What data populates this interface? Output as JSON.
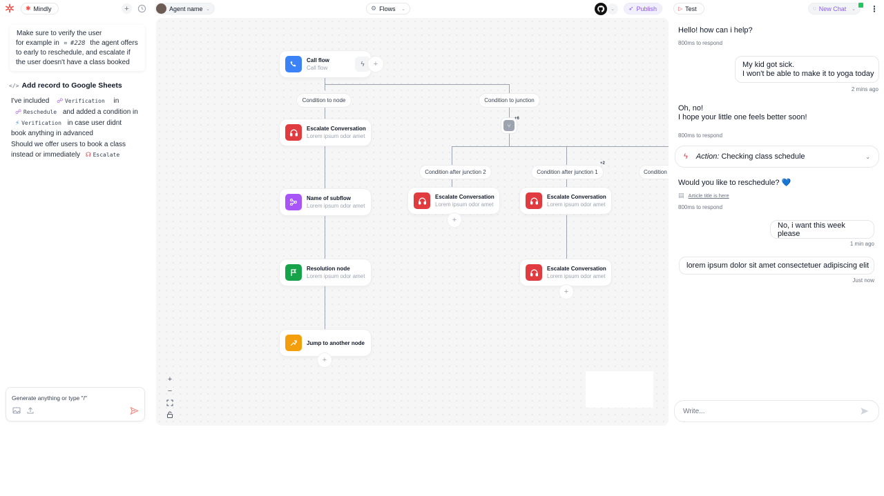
{
  "header": {
    "brand_name": "Mindly",
    "agent_name": "Agent name",
    "flows_label": "Flows",
    "publish_label": "Publish",
    "test_label": "Test",
    "new_chat_label": "New Chat"
  },
  "left_panel": {
    "note": {
      "line1": "Make sure to verify the user",
      "line2a": "for example in",
      "line2_ref": "#228",
      "line2b": "the agent offers",
      "line3": "to early to reschedule, and escalate if",
      "line4": "the user doesn't have a class booked"
    },
    "action_title": "Add record to Google Sheets",
    "description": {
      "l1_pre": "I've included",
      "tag_verification": "Verification",
      "l1_post": "in",
      "tag_reschedule": "Reschedule",
      "l2_post": "and added a condition in",
      "tag_verification2": "Verification",
      "l3_post": "in case user didnt",
      "l4": "book anything in advanced",
      "l5": "Should we offer users to book a class",
      "l6_pre": "instead or immediately",
      "tag_escalate": "Escalate"
    },
    "prompt_placeholder": "Generate anything or type \"/\""
  },
  "canvas": {
    "call_flow": {
      "title": "Call flow",
      "subtitle": "Call flow"
    },
    "conditions": {
      "to_node": "Condition to node",
      "to_junction": "Condition to junction",
      "after_junction_2": "Condition after junction 2",
      "after_junction_1": "Condition after junction 1",
      "cut_off": "Condition"
    },
    "junction_badge": "+6",
    "junction_badge_2": "+2",
    "nodes": {
      "escalate_title": "Escalate Conversation",
      "lorem": "Lorem ipsum odor amet",
      "subflow_title": "Name of subflow",
      "resolution_title": "Resolution node",
      "jump_title": "Jump to another node"
    }
  },
  "chat": {
    "msg1": "Hello! how can i help?",
    "meta_respond": "800ms to respond",
    "user1_line1": "My kid got sick.",
    "user1_line2": "I won't be able to make it to yoga today",
    "time1": "2 mins ago",
    "msg2_line1": "Oh, no!",
    "msg2_line2": "I hope your little one feels better soon!",
    "action_prefix": "Action:",
    "action_text": "Checking class schedule",
    "msg3": "Would you like to reschedule? 💙",
    "article_link": "Article title is here",
    "user2": "No, i want this week please",
    "time2": "1 min ago",
    "user3": "lorem ipsum dolor sit amet consectetuer adipiscing elit",
    "time3": "Just now",
    "compose_placeholder": "Write..."
  },
  "colors": {
    "brand": "#f0524c",
    "publish": "#8b5cf6",
    "escalate": "#e03b3f",
    "subflow": "#a855f7",
    "resolution": "#16a34a",
    "jump": "#f59e0b",
    "callflow": "#3b82f6"
  }
}
